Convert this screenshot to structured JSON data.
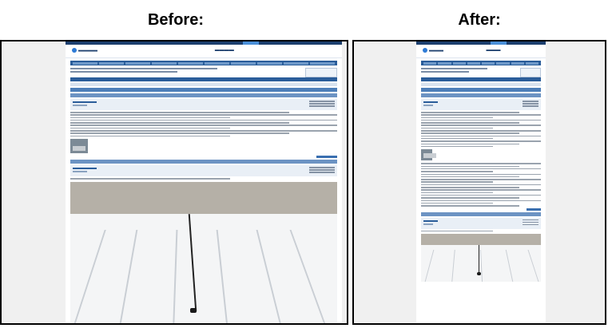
{
  "headings": {
    "before": "Before:",
    "after": "After:"
  }
}
